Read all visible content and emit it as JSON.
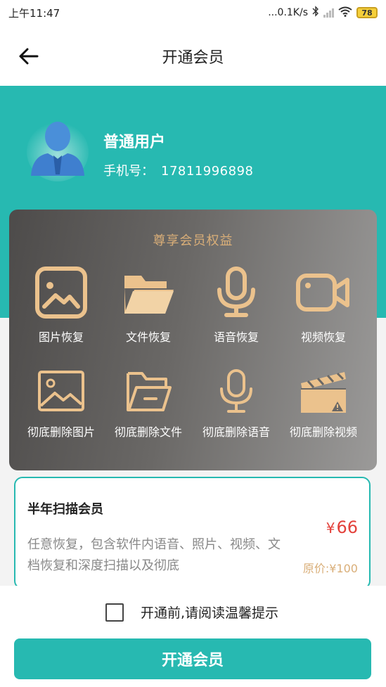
{
  "status_bar": {
    "time": "上午11:47",
    "net_speed": "...0.1K/s",
    "battery": "78"
  },
  "nav": {
    "title": "开通会员"
  },
  "user": {
    "name": "普通用户",
    "phone_label": "手机号：",
    "phone": "17811996898"
  },
  "benefits": {
    "title": "尊享会员权益",
    "items": [
      {
        "label": "图片恢复",
        "icon": "picture-icon"
      },
      {
        "label": "文件恢复",
        "icon": "folder-icon"
      },
      {
        "label": "语音恢复",
        "icon": "microphone-icon"
      },
      {
        "label": "视频恢复",
        "icon": "video-camera-icon"
      },
      {
        "label": "彻底删除图片",
        "icon": "picture-outline-icon"
      },
      {
        "label": "彻底删除文件",
        "icon": "folder-outline-icon"
      },
      {
        "label": "彻底删除语音",
        "icon": "microphone-outline-icon"
      },
      {
        "label": "彻底删除视频",
        "icon": "clapperboard-icon"
      }
    ],
    "accent_color": "#d9ae78"
  },
  "plan": {
    "name": "半年扫描会员",
    "description": "任意恢复，包含软件内语音、照片、视频、文档恢复和深度扫描以及彻底",
    "currency": "¥",
    "price": "66",
    "original_price": "原价:¥100"
  },
  "footer": {
    "agree_text": "开通前,请阅读温馨提示",
    "cta_label": "开通会员"
  },
  "colors": {
    "brand": "#27b9b1",
    "price": "#e3413b"
  }
}
